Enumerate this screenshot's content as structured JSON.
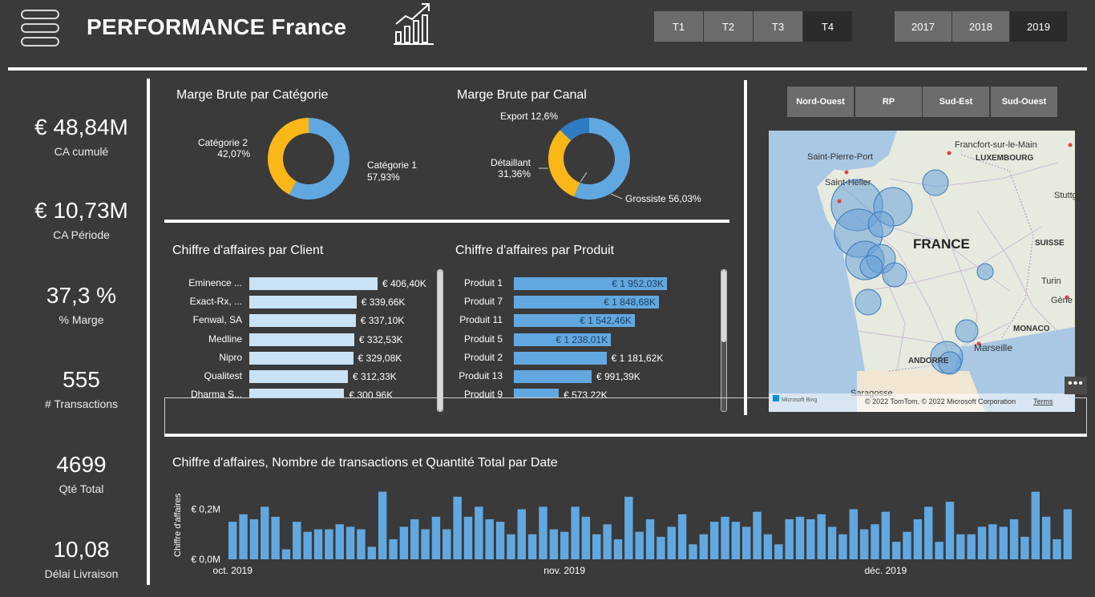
{
  "header": {
    "title": "PERFORMANCE France",
    "quarters": [
      {
        "label": "T1",
        "selected": false
      },
      {
        "label": "T2",
        "selected": false
      },
      {
        "label": "T3",
        "selected": false
      },
      {
        "label": "T4",
        "selected": true
      }
    ],
    "years": [
      {
        "label": "2017",
        "selected": false
      },
      {
        "label": "2018",
        "selected": false
      },
      {
        "label": "2019",
        "selected": true
      }
    ]
  },
  "kpis": [
    {
      "value": "€ 48,84M",
      "label": "CA cumulé"
    },
    {
      "value": "€ 10,73M",
      "label": "CA Période"
    },
    {
      "value": "37,3 %",
      "label": "% Marge"
    },
    {
      "value": "555",
      "label": "# Transactions"
    },
    {
      "value": "4699",
      "label": "Qté Total"
    },
    {
      "value": "10,08",
      "label": "Délai Livraison"
    }
  ],
  "regions": [
    "Nord-Ouest",
    "RP",
    "Sud-Est",
    "Sud-Ouest"
  ],
  "map": {
    "labels": {
      "saint_pierre": "Saint-Pierre-Port",
      "saint_helier": "Saint-Helier",
      "francfort": "Francfort-sur-le-Main",
      "luxembourg": "LUXEMBOURG",
      "stuttg": "Stuttg",
      "france": "FRANCE",
      "suisse": "SUISSE",
      "turin": "Turin",
      "gene": "Gène",
      "monaco": "MONACO",
      "marseille": "Marseille",
      "andorre": "ANDORRE",
      "saragosse": "Saragosse"
    },
    "attribution": "© 2022 TomTom, © 2022 Microsoft Corporation",
    "terms": "Terms",
    "bing": "Microsoft Bing"
  },
  "colors": {
    "blue": "#62a8e0",
    "orange": "#fbb718",
    "dark_blue": "#2f7bc4",
    "light_bar": "#c9e2f5",
    "bg": "#3a3a3a"
  },
  "chart_data": [
    {
      "type": "pie",
      "title": "Marge Brute par Catégorie",
      "slices": [
        {
          "name": "Catégorie 1",
          "value": 57.93,
          "label": "57,93%"
        },
        {
          "name": "Catégorie 2",
          "value": 42.07,
          "label": "42,07%"
        }
      ]
    },
    {
      "type": "pie",
      "title": "Marge Brute par Canal",
      "slices": [
        {
          "name": "Grossiste",
          "value": 56.03,
          "label": "Grossiste 56,03%"
        },
        {
          "name": "Détaillant",
          "value": 31.36,
          "label": "31,36%"
        },
        {
          "name": "Export",
          "value": 12.6,
          "label": "Export 12,6%"
        }
      ]
    },
    {
      "type": "bar",
      "title": "Chiffre d'affaires par Client",
      "categories": [
        "Eminence ...",
        "Exact-Rx, ...",
        "Fenwal, SA",
        "Medline",
        "Nipro",
        "Qualitest",
        "Dharma S..."
      ],
      "values": [
        406.4,
        339.66,
        337.1,
        332.53,
        329.08,
        312.33,
        300.96
      ],
      "labels": [
        "€ 406,40K",
        "€ 339,66K",
        "€ 337,10K",
        "€ 332,53K",
        "€ 329,08K",
        "€ 312,33K",
        "€ 300,96K"
      ]
    },
    {
      "type": "bar",
      "title": "Chiffre d'affaires par Produit",
      "categories": [
        "Produit 1",
        "Produit 7",
        "Produit 11",
        "Produit 5",
        "Produit 2",
        "Produit 13",
        "Produit 9"
      ],
      "values": [
        1952.03,
        1848.68,
        1542.46,
        1238.01,
        1181.62,
        991.39,
        573.22
      ],
      "labels": [
        "€ 1 952,03K",
        "€ 1 848,68K",
        "€ 1 542,46K",
        "€ 1 238,01K",
        "€ 1 181,62K",
        "€ 991,39K",
        "€ 573,22K"
      ]
    },
    {
      "type": "bar",
      "title": "Chiffre d'affaires, Nombre de transactions et Quantité Total par Date",
      "ylabel": "Chiffre d'affaires",
      "y_ticks": [
        "€ 0,0M",
        "€ 0,2M"
      ],
      "y_tick_values": [
        0,
        0.2
      ],
      "ylim": [
        0,
        0.32
      ],
      "x_ticks": [
        {
          "label": "oct. 2019",
          "index": 0
        },
        {
          "label": "nov. 2019",
          "index": 31
        },
        {
          "label": "déc. 2019",
          "index": 61
        }
      ],
      "values": [
        0.15,
        0.18,
        0.16,
        0.21,
        0.17,
        0.04,
        0.15,
        0.11,
        0.12,
        0.12,
        0.14,
        0.13,
        0.12,
        0.05,
        0.27,
        0.08,
        0.13,
        0.16,
        0.12,
        0.17,
        0.12,
        0.25,
        0.17,
        0.21,
        0.16,
        0.15,
        0.1,
        0.2,
        0.1,
        0.21,
        0.12,
        0.11,
        0.21,
        0.17,
        0.1,
        0.14,
        0.08,
        0.25,
        0.11,
        0.16,
        0.09,
        0.13,
        0.18,
        0.06,
        0.1,
        0.15,
        0.17,
        0.15,
        0.13,
        0.19,
        0.1,
        0.06,
        0.16,
        0.17,
        0.16,
        0.18,
        0.13,
        0.1,
        0.2,
        0.12,
        0.14,
        0.19,
        0.07,
        0.11,
        0.16,
        0.21,
        0.07,
        0.23,
        0.1,
        0.1,
        0.13,
        0.14,
        0.13,
        0.16,
        0.09,
        0.27,
        0.17,
        0.08,
        0.2
      ]
    }
  ]
}
